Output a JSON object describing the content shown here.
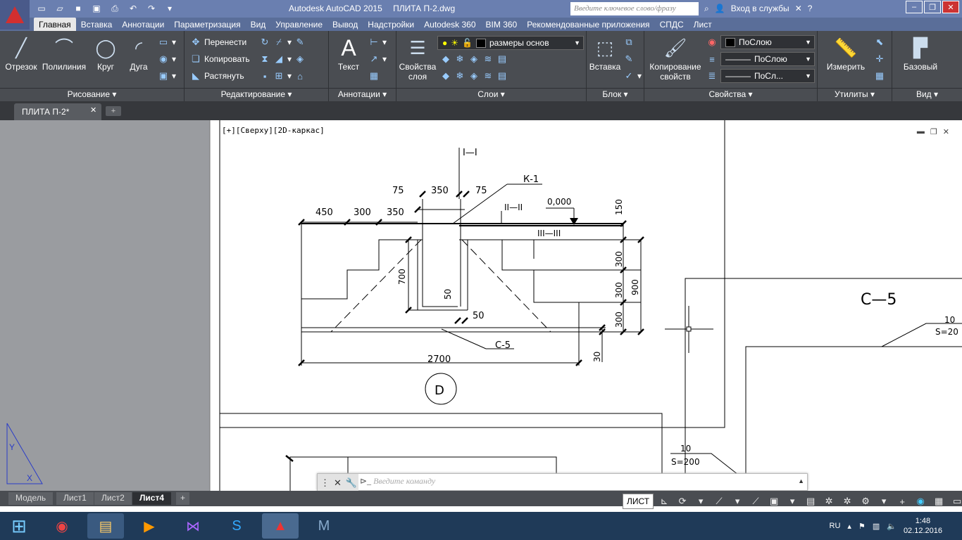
{
  "title": {
    "app": "Autodesk AutoCAD 2015",
    "file": "ПЛИТА П-2.dwg",
    "search_placeholder": "Введите ключевое слово/фразу",
    "login": "Вход в службы"
  },
  "ribbon_tabs": [
    "Главная",
    "Вставка",
    "Аннотации",
    "Параметризация",
    "Вид",
    "Управление",
    "Вывод",
    "Надстройки",
    "Autodesk 360",
    "BIM 360",
    "Рекомендованные приложения",
    "СПДС",
    "Лист"
  ],
  "ribbon": {
    "draw": {
      "title": "Рисование",
      "line": "Отрезок",
      "polyline": "Полилиния",
      "circle": "Круг",
      "arc": "Дуга"
    },
    "modify": {
      "title": "Редактирование",
      "move": "Перенести",
      "copy": "Копировать",
      "stretch": "Растянуть"
    },
    "annotation": {
      "title": "Аннотации",
      "text": "Текст"
    },
    "layers": {
      "title": "Слои",
      "properties": "Свойства слоя",
      "current_layer": "размеры основ"
    },
    "block": {
      "title": "Блок",
      "insert": "Вставка"
    },
    "properties": {
      "title": "Свойства",
      "match": "Копирование свойств",
      "color": "ПоСлою",
      "linetype": "ПоСлою",
      "lineweight": "ПоСл..."
    },
    "utilities": {
      "title": "Утилиты",
      "measure": "Измерить"
    },
    "view": {
      "title": "Вид",
      "base": "Базовый"
    }
  },
  "file_tab": "ПЛИТА П-2*",
  "viewport_label": "[+][Сверху][2D-каркас]",
  "drawing": {
    "section1": "I—I",
    "section2": "II—II",
    "section3": "III—III",
    "k1": "К-1",
    "elev": "0,000",
    "c5a": "С-5",
    "c5b": "С—5",
    "d": "D",
    "d75a": "75",
    "d350top": "350",
    "d75b": "75",
    "d450": "450",
    "d300": "300",
    "d350": "350",
    "d150": "150",
    "d700": "700",
    "d50v": "50",
    "d50h": "50",
    "d300a": "300",
    "d300b": "300",
    "d300c": "300",
    "d900": "900",
    "d30": "30",
    "d2700": "2700",
    "r10a": "10",
    "s200a": "S=20",
    "r10b": "10",
    "s200b": "S=200"
  },
  "command_placeholder": "Введите команду",
  "layout_tabs": [
    "Модель",
    "Лист1",
    "Лист2",
    "Лист4"
  ],
  "status": {
    "mode": "ЛИСТ"
  },
  "tray": {
    "lang": "RU",
    "time": "1:48",
    "date": "02.12.2016"
  }
}
